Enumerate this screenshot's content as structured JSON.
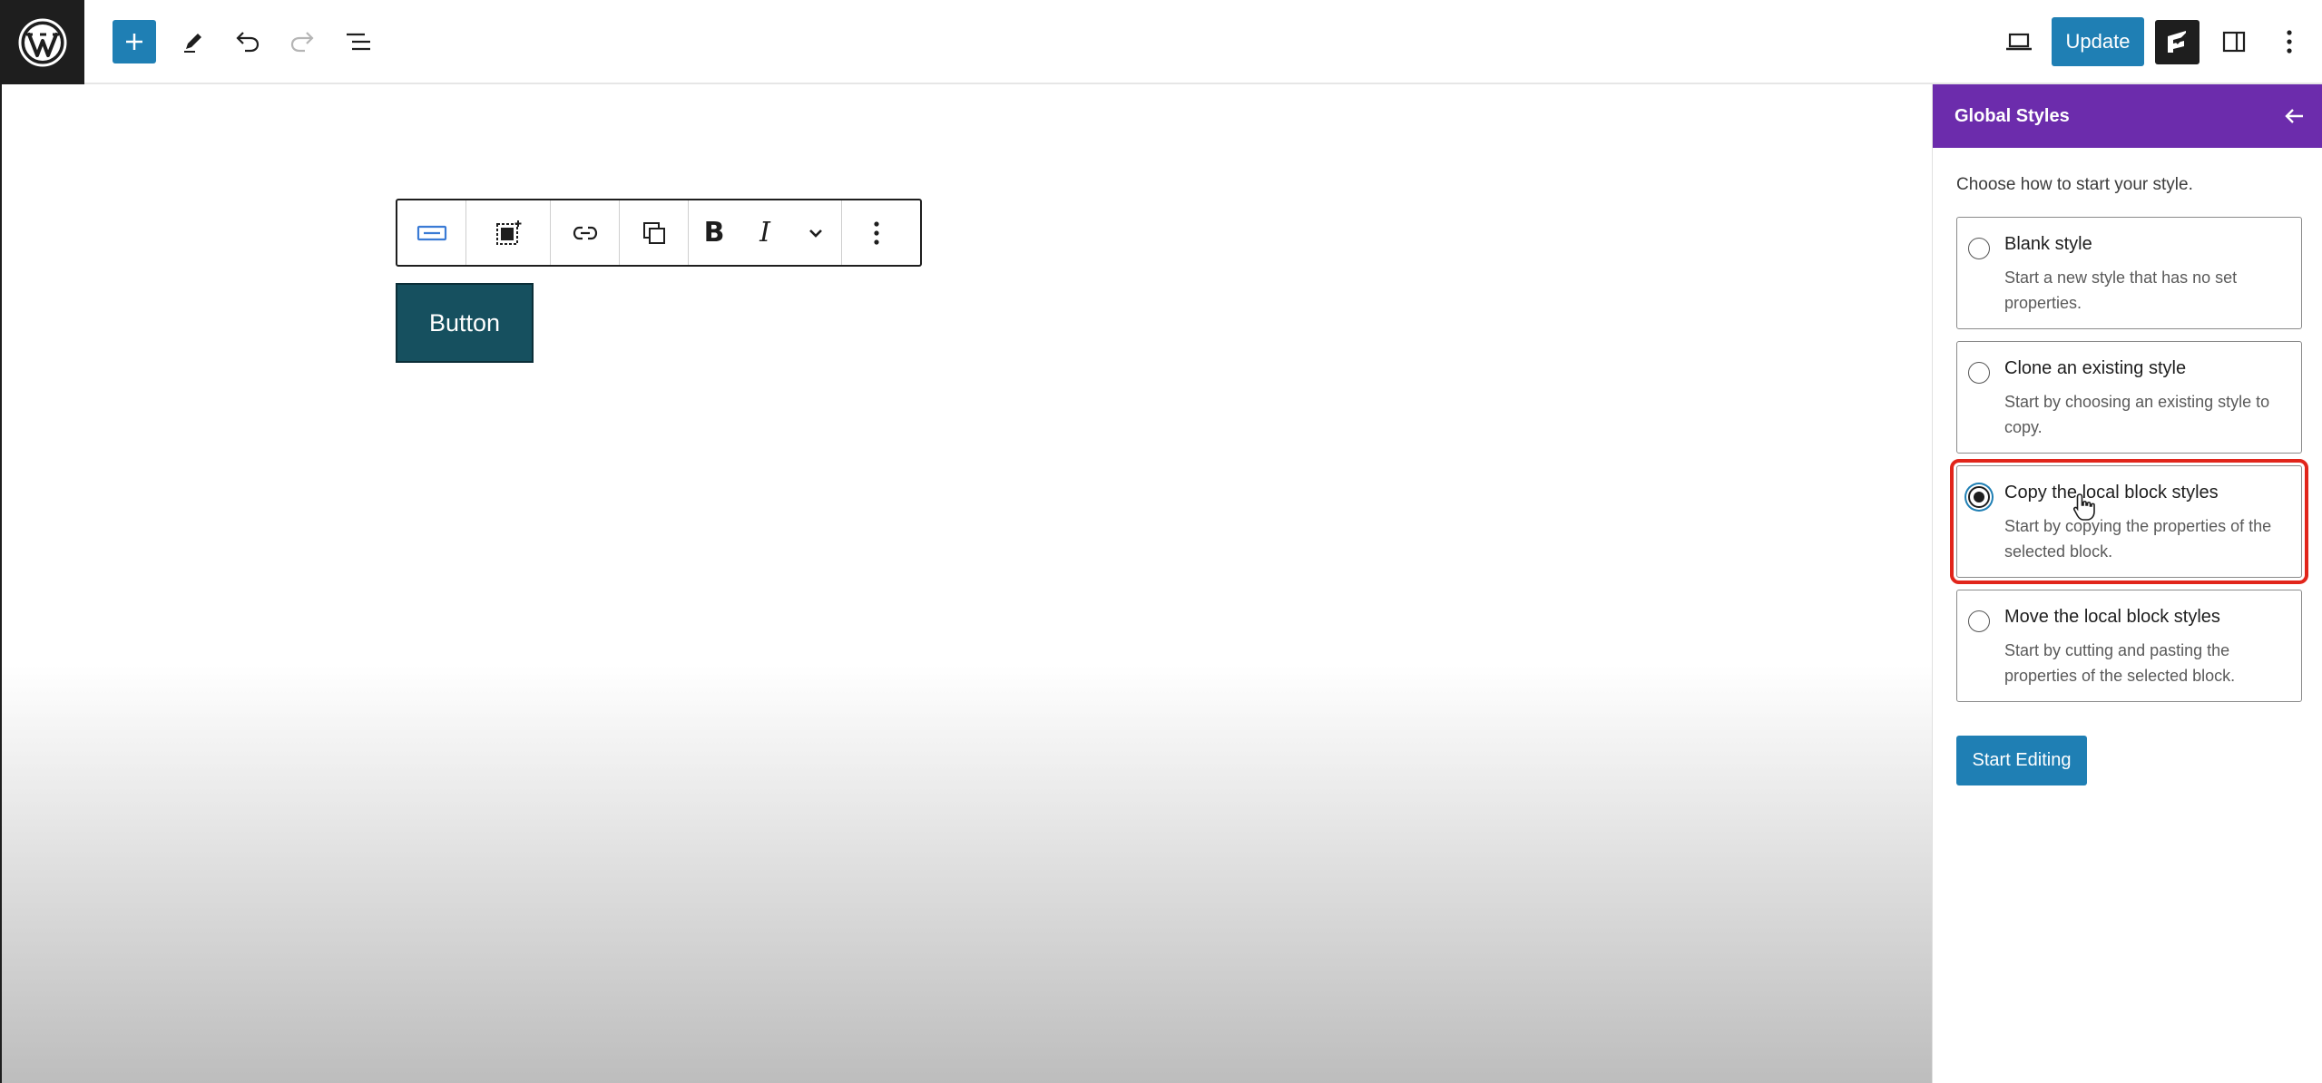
{
  "topbar": {
    "update_label": "Update",
    "icons": [
      "wordpress-logo",
      "plus-icon",
      "pencil-icon",
      "undo-icon",
      "redo-icon",
      "list-view-icon",
      "desktop-preview-icon",
      "brand-logo-icon",
      "sidebar-toggle-icon",
      "more-options-icon"
    ]
  },
  "canvas": {
    "block_toolbar": {
      "icons": [
        "button-block-icon",
        "select-parent-icon",
        "link-icon",
        "duplicate-styles-icon",
        "bold-icon",
        "italic-icon",
        "chevron-down-icon",
        "more-vertical-icon"
      ],
      "bold_glyph": "B",
      "italic_glyph": "I"
    },
    "button_label": "Button"
  },
  "sidebar": {
    "title": "Global Styles",
    "intro": "Choose how to start your style.",
    "options": [
      {
        "title": "Blank style",
        "description": "Start a new style that has no set properties.",
        "selected": false
      },
      {
        "title": "Clone an existing style",
        "description": "Start by choosing an existing style to copy.",
        "selected": false
      },
      {
        "title": "Copy the local block styles",
        "description": "Start by copying the properties of the selected block.",
        "selected": true
      },
      {
        "title": "Move the local block styles",
        "description": "Start by cutting and pasting the properties of the selected block.",
        "selected": false
      }
    ],
    "start_label": "Start Editing"
  },
  "colors": {
    "wp_blue": "#1f7fb4",
    "header_purple": "#6c2cac",
    "button_teal": "#16505f",
    "highlight_red": "#e1251b",
    "dark": "#1e1e1e"
  }
}
